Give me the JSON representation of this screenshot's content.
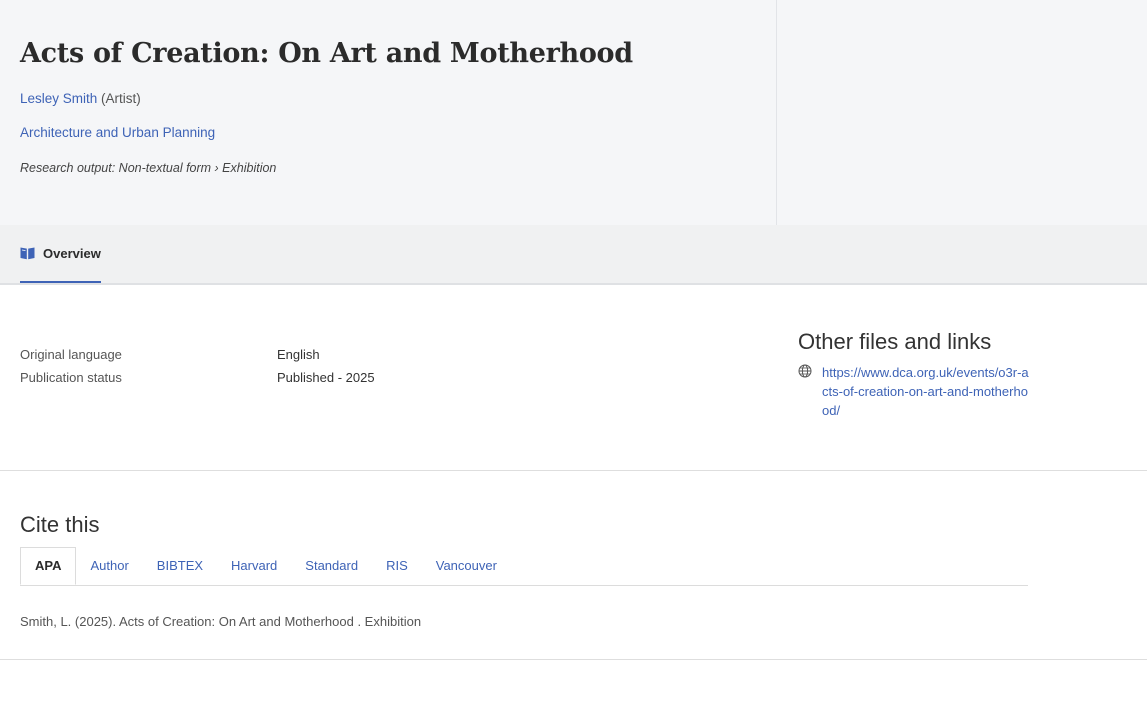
{
  "header": {
    "title": "Acts of Creation: On Art and Motherhood",
    "person_name": "Lesley Smith",
    "person_role": " (Artist)",
    "organisation": "Architecture and Urban Planning",
    "research_output": "Research output: Non-textual form › Exhibition"
  },
  "tabs": {
    "overview_label": "Overview",
    "overview_icon": "book-icon"
  },
  "metadata": {
    "rows": [
      {
        "key": "Original language",
        "value": "English"
      },
      {
        "key": "Publication status",
        "value": "Published - 2025"
      }
    ]
  },
  "sidebar": {
    "title": "Other files and links",
    "link_icon": "globe-icon",
    "link_url": "https://www.dca.org.uk/events/o3r-acts-of-creation-on-art-and-motherhood/"
  },
  "cite": {
    "title": "Cite this",
    "tabs": [
      "APA",
      "Author",
      "BIBTEX",
      "Harvard",
      "Standard",
      "RIS",
      "Vancouver"
    ],
    "active_tab": "APA",
    "text": "Smith, L. (2025). Acts of Creation: On Art and Motherhood . Exhibition"
  },
  "colors": {
    "link": "#3e63b6",
    "header_bg": "#f5f6f8",
    "tabbar_bg": "#f0f1f2"
  }
}
